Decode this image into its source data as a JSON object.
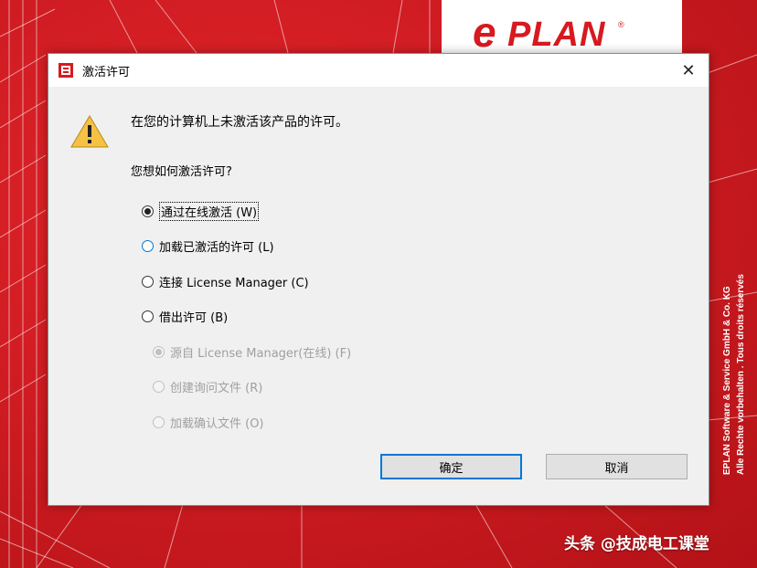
{
  "background": {
    "brand_color": "#d71920",
    "logo_e": "e",
    "logo_rest": "PLAN",
    "logo_reg": "®",
    "side_text": [
      "EPLAN Software & Service GmbH & Co. KG",
      "Alle Rechte vorbehalten . Tous droits réservés"
    ]
  },
  "dialog": {
    "title": "激活许可",
    "close_label": "✕",
    "message": "在您的计算机上未激活该产品的许可。",
    "question": "您想如何激活许可?",
    "options": [
      {
        "label": "通过在线激活 (W)",
        "checked": true,
        "enabled": true
      },
      {
        "label": "加载已激活的许可 (L)",
        "checked": false,
        "enabled": true
      },
      {
        "label": "连接 License Manager (C)",
        "checked": false,
        "enabled": true
      },
      {
        "label": "借出许可 (B)",
        "checked": false,
        "enabled": true
      }
    ],
    "sub_options": [
      {
        "label": "源自 License Manager(在线) (F)",
        "checked": true,
        "enabled": false
      },
      {
        "label": "创建询问文件 (R)",
        "checked": false,
        "enabled": false
      },
      {
        "label": "加载确认文件 (O)",
        "checked": false,
        "enabled": false
      }
    ],
    "ok_label": "确定",
    "cancel_label": "取消"
  },
  "watermark": "头条 @技成电工课堂"
}
